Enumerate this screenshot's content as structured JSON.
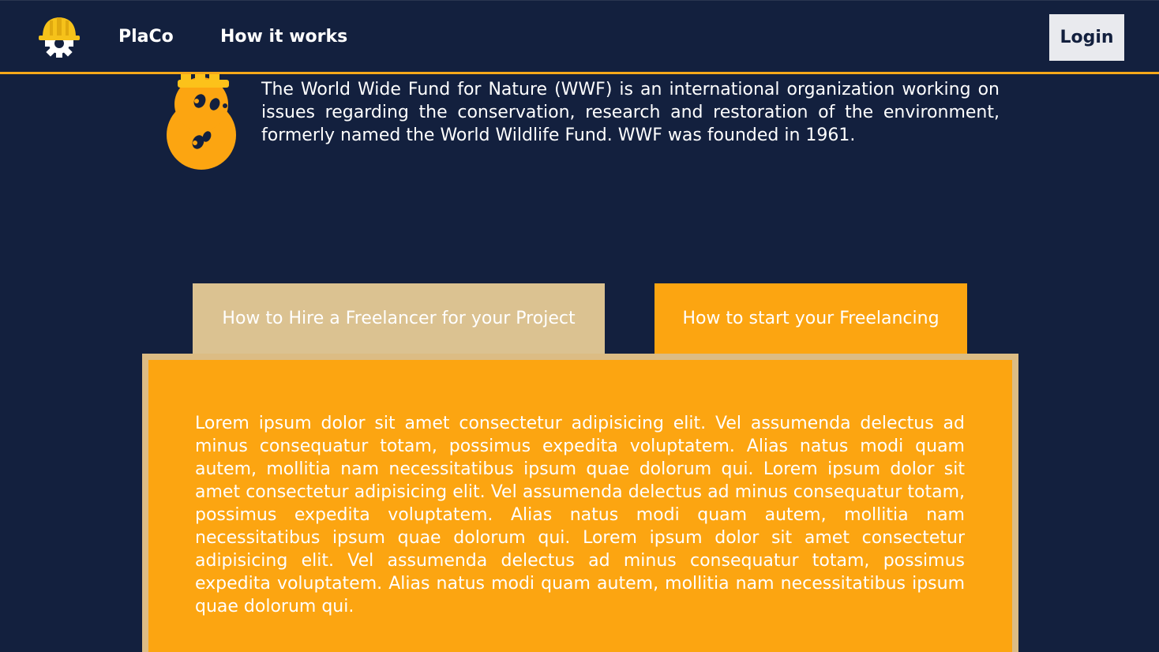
{
  "navbar": {
    "brand": "PlaCo",
    "how_it_works": "How it works",
    "login_label": "Login"
  },
  "intro": {
    "text": "The World Wide Fund for Nature (WWF) is an international organization working on issues regarding the conservation, research and restoration of the environment, formerly named the World Wildlife Fund. WWF was founded in 1961."
  },
  "tabs": [
    {
      "label": "How to Hire a Freelancer for your Project"
    },
    {
      "label": "How to start your Freelancing"
    }
  ],
  "panel": {
    "text": "Lorem ipsum dolor sit amet consectetur adipisicing elit. Vel assumenda delectus ad minus consequatur totam, possimus expedita voluptatem. Alias natus modi quam autem, mollitia nam necessitatibus ipsum quae dolorum qui. Lorem ipsum dolor sit amet consectetur adipisicing elit. Vel assumenda delectus ad minus consequatur totam, possimus expedita voluptatem. Alias natus modi quam autem, mollitia nam necessitatibus ipsum quae dolorum qui. Lorem ipsum dolor sit amet consectetur adipisicing elit. Vel assumenda delectus ad minus consequatur totam, possimus expedita voluptatem. Alias natus modi quam autem, mollitia nam necessitatibus ipsum quae dolorum qui."
  },
  "icons": {
    "logo": "hardhat-gear-icon",
    "mascot": "hardhat-mascot-icon"
  },
  "colors": {
    "background": "#13203e",
    "accent": "#fca511",
    "tab_inactive": "#dbc291",
    "panel_border": "#dcbc84",
    "login_bg": "#e9eaee"
  }
}
